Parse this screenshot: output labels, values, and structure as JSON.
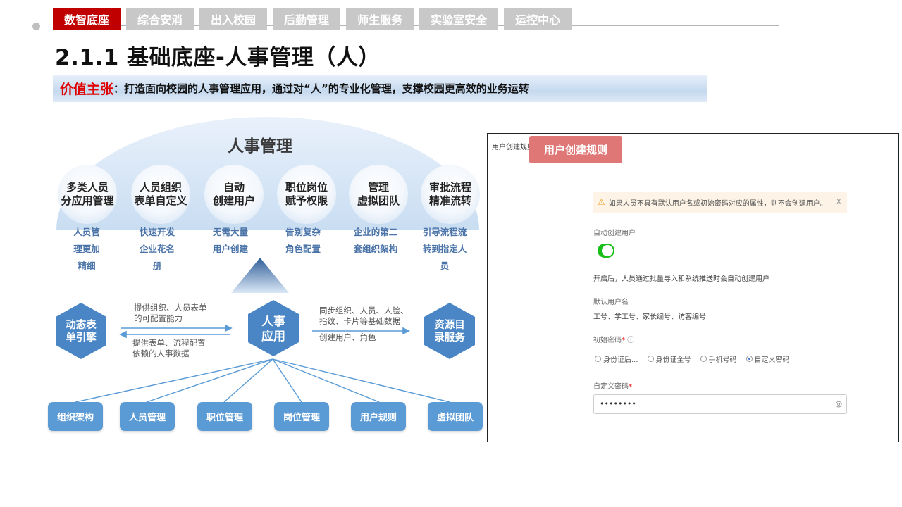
{
  "nav": {
    "tabs": [
      {
        "label": "数智底座",
        "active": true
      },
      {
        "label": "综合安消",
        "active": false
      },
      {
        "label": "出入校园",
        "active": false
      },
      {
        "label": "后勤管理",
        "active": false
      },
      {
        "label": "师生服务",
        "active": false
      },
      {
        "label": "实验室安全",
        "active": false
      },
      {
        "label": "运控中心",
        "active": false
      }
    ]
  },
  "page": {
    "title": "2.1.1 基础底座-人事管理（人）",
    "value_label": "价值主张",
    "value_text": "：打造面向校园的人事管理应用，通过对“人”的专业化管理，支撑校园更高效的业务运转"
  },
  "diagram": {
    "title": "人事管理",
    "features": [
      {
        "name": "多类人员\n分应用管理",
        "desc": "人员管\n理更加\n精细"
      },
      {
        "name": "人员组织\n表单自定义",
        "desc": "快速开发\n企业花名\n册"
      },
      {
        "name": "自动\n创建用户",
        "desc": "无需大量\n用户创建"
      },
      {
        "name": "职位岗位\n赋予权限",
        "desc": "告别复杂\n角色配置"
      },
      {
        "name": "管理\n虚拟团队",
        "desc": "企业的第二\n套组织架构"
      },
      {
        "name": "审批流程\n精准流转",
        "desc": "引导流程流\n转到指定人\n员"
      }
    ],
    "left_hex": "动态表\n单引擎",
    "center_hex": "人事\n应用",
    "right_hex": "资源目\n录服务",
    "left_top_text": "提供组织、人员表单\n的可配置能力",
    "left_bottom_text": "提供表单、流程配置\n依赖的人事数据",
    "right_top_text": "同步组织、人员、人脸、\n指纹、卡片等基础数据",
    "right_bottom_text": "创建用户、角色",
    "modules": [
      "组织架构",
      "人员管理",
      "职位管理",
      "岗位管理",
      "用户规则",
      "虚拟团队"
    ]
  },
  "panel": {
    "header": "用户创建规则",
    "badge": "用户创建规则",
    "alert": "如果人员不具有默认用户名或初始密码对应的属性，则不会创建用户。",
    "auto_create_label": "自动创建用户",
    "auto_create_on": true,
    "auto_create_desc": "开启后，人员通过批量导入和系统推送时会自动创建用户",
    "default_username_label": "默认用户名",
    "default_username_value": "工号、学工号、家长编号、访客编号",
    "init_password_label": "初始密码",
    "password_options": [
      {
        "label": "身份证后...",
        "selected": false
      },
      {
        "label": "身份证全号",
        "selected": false
      },
      {
        "label": "手机号码",
        "selected": false
      },
      {
        "label": "自定义密码",
        "selected": true
      }
    ],
    "custom_password_label": "自定义密码",
    "custom_password_value": "••••••••"
  },
  "colors": {
    "accent_red": "#c00000",
    "tab_gray": "#c8c8c8",
    "module_blue": "#5b9bd5",
    "hex_blue": "#4a86c5",
    "badge_pink": "#e07777",
    "toggle_green": "#19be19"
  }
}
